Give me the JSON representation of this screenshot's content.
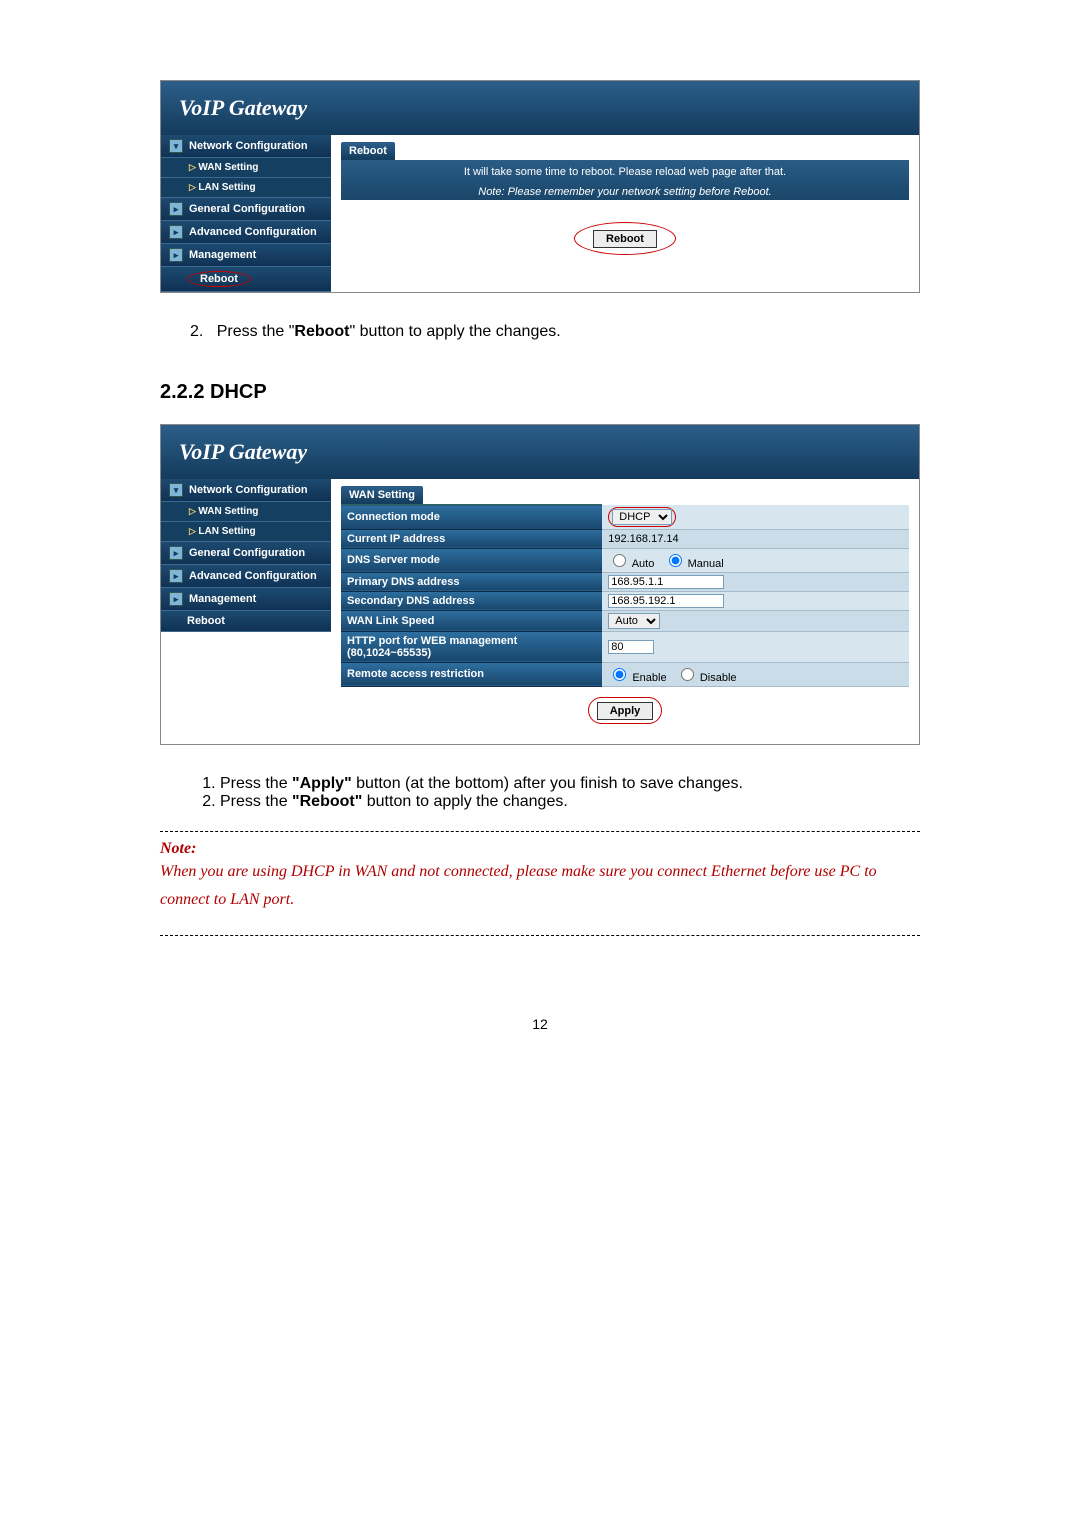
{
  "page_number": "12",
  "ss1": {
    "title": "VoIP  Gateway",
    "sidebar": {
      "network": "Network Configuration",
      "wan": "WAN Setting",
      "lan": "LAN Setting",
      "general": "General Configuration",
      "advanced": "Advanced Configuration",
      "management": "Management",
      "reboot": "Reboot"
    },
    "panel_label": "Reboot",
    "line1": "It will take some time to reboot. Please reload web page after that.",
    "line2": "Note: Please remember your network setting before Reboot.",
    "reboot_btn": "Reboot"
  },
  "step_reboot": "Press the \"",
  "step_reboot_bold": "Reboot",
  "step_reboot_tail": "\" button to apply the changes.",
  "section": "2.2.2  DHCP",
  "ss2": {
    "title": "VoIP  Gateway",
    "sidebar": {
      "network": "Network Configuration",
      "wan": "WAN Setting",
      "lan": "LAN Setting",
      "general": "General Configuration",
      "advanced": "Advanced Configuration",
      "management": "Management",
      "reboot": "Reboot"
    },
    "panel_label": "WAN Setting",
    "rows": {
      "conn_mode": "Connection mode",
      "conn_mode_val": "DHCP",
      "ip_label": "Current IP address",
      "ip_val": "192.168.17.14",
      "dns_mode": "DNS Server mode",
      "dns_mode_auto": "Auto",
      "dns_mode_manual": "Manual",
      "pdns": "Primary DNS address",
      "pdns_val": "168.95.1.1",
      "sdns": "Secondary DNS address",
      "sdns_val": "168.95.192.1",
      "link": "WAN Link Speed",
      "link_val": "Auto",
      "http": "HTTP port for WEB management (80,1024~65535)",
      "http_val": "80",
      "remote": "Remote access restriction",
      "remote_enable": "Enable",
      "remote_disable": "Disable"
    },
    "apply_btn": "Apply"
  },
  "steps": {
    "s1a": "Press the ",
    "s1b": "\"Apply\"",
    "s1c": " button (at the bottom) after you finish to save changes.",
    "s2a": "Press the ",
    "s2b": "\"Reboot\"",
    "s2c": " button to apply the changes."
  },
  "note_title": "Note:",
  "note_body": "When you are using DHCP in WAN and not connected, please make sure you connect Ethernet before use PC to connect to LAN port."
}
